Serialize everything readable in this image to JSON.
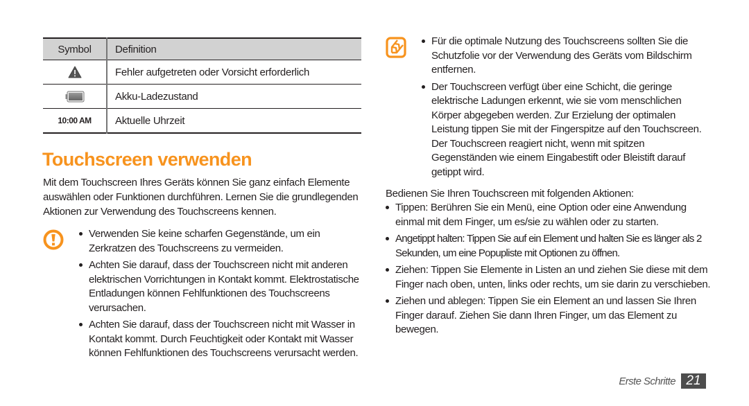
{
  "table": {
    "headers": {
      "symbol": "Symbol",
      "definition": "Definition"
    },
    "rows": [
      {
        "symbol_icon": "warning-triangle-icon",
        "symbol_text": "",
        "definition": "Fehler aufgetreten oder Vorsicht erforderlich"
      },
      {
        "symbol_icon": "battery-icon",
        "symbol_text": "",
        "definition": "Akku-Ladezustand"
      },
      {
        "symbol_icon": "",
        "symbol_text": "10:00 AM",
        "definition": "Aktuelle Uhrzeit"
      }
    ]
  },
  "section": {
    "title": "Touchscreen verwenden",
    "intro": "Mit dem Touchscreen Ihres Geräts können Sie ganz einfach Elemente auswählen oder Funktionen durchführen. Lernen Sie die grundlegenden Aktionen zur Verwendung des Touchscreens kennen."
  },
  "caution": {
    "icon": "caution-icon",
    "bullets": [
      "Verwenden Sie keine scharfen Gegenstände, um ein Zerkratzen des Touchscreens zu vermeiden.",
      "Achten Sie darauf, dass der Touchscreen nicht mit anderen elektrischen Vorrichtungen in Kontakt kommt. Elektrostatische Entladungen können Fehlfunktionen des Touchscreens verursachen.",
      "Achten Sie darauf, dass der Touchscreen nicht mit Wasser in Kontakt kommt. Durch Feuchtigkeit oder Kontakt mit Wasser können Fehlfunktionen des Touchscreens verursacht werden."
    ]
  },
  "note": {
    "icon": "note-pencil-icon",
    "bullets": [
      "Für die optimale Nutzung des Touchscreens sollten Sie die Schutzfolie vor der Verwendung des Geräts vom Bildschirm entfernen.",
      "Der Touchscreen verfügt über eine Schicht, die geringe elektrische Ladungen erkennt, wie sie vom menschlichen Körper abgegeben werden. Zur Erzielung der optimalen Leistung tippen Sie mit der Fingerspitze auf den Touchscreen. Der Touchscreen reagiert nicht, wenn mit spitzen Gegenständen wie einem Eingabestift oder Bleistift darauf getippt wird."
    ]
  },
  "actions": {
    "intro": "Bedienen Sie Ihren Touchscreen mit folgenden Aktionen:",
    "items": [
      "Tippen: Berühren Sie ein Menü, eine Option oder eine Anwendung einmal mit dem Finger, um es/sie zu wählen oder zu starten.",
      "Angetippt halten: Tippen Sie auf ein Element und halten Sie es länger als 2 Sekunden, um eine Popupliste mit Optionen zu öffnen.",
      "Ziehen: Tippen Sie Elemente in Listen an und ziehen Sie diese mit dem Finger nach oben, unten, links oder rechts, um sie darin zu verschieben.",
      "Ziehen und ablegen: Tippen Sie ein Element an und lassen Sie Ihren Finger darauf. Ziehen Sie dann Ihren Finger, um das Element zu bewegen."
    ]
  },
  "footer": {
    "chapter": "Erste Schritte",
    "page": "21"
  },
  "colors": {
    "accent": "#f7931e",
    "text": "#231f20",
    "header_bg": "#d2d2d2",
    "page_badge": "#4d4d4d"
  }
}
